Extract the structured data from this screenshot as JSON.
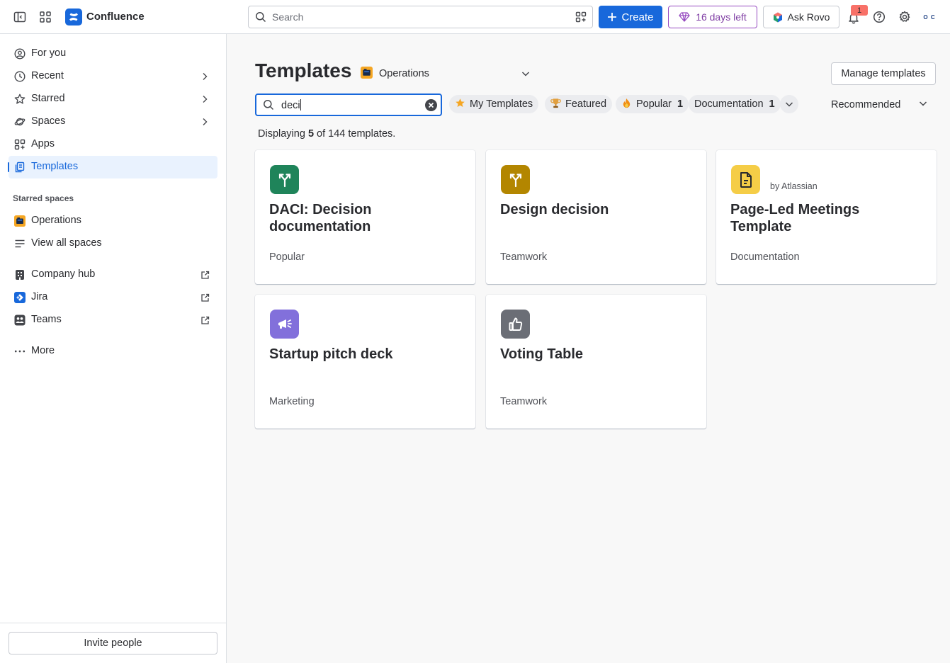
{
  "topbar": {
    "brand": "Confluence",
    "search_placeholder": "Search",
    "create_label": "Create",
    "trial_label": "16 days left",
    "rovo_label": "Ask Rovo",
    "notification_count": "1",
    "avatar_text": "O C"
  },
  "sidebar": {
    "items": [
      {
        "label": "For you"
      },
      {
        "label": "Recent"
      },
      {
        "label": "Starred"
      },
      {
        "label": "Spaces"
      },
      {
        "label": "Apps"
      },
      {
        "label": "Templates"
      }
    ],
    "starred_spaces_title": "Starred spaces",
    "starred_spaces": [
      {
        "label": "Operations"
      },
      {
        "label": "View all spaces"
      }
    ],
    "external": [
      {
        "label": "Company hub"
      },
      {
        "label": "Jira"
      },
      {
        "label": "Teams"
      }
    ],
    "more_label": "More",
    "invite_label": "Invite people"
  },
  "main": {
    "title": "Templates",
    "space_name": "Operations",
    "manage_label": "Manage templates",
    "search_value": "deci",
    "filters": [
      {
        "label": "My Templates",
        "count": ""
      },
      {
        "label": "Featured",
        "count": ""
      },
      {
        "label": "Popular",
        "count": "1"
      },
      {
        "label": "Documentation",
        "count": "1"
      }
    ],
    "sort_label": "Recommended",
    "display_prefix": "Displaying",
    "display_shown": "5",
    "display_mid": "of 144 templates.",
    "cards": [
      {
        "title": "DACI: Decision documentation",
        "category": "Popular",
        "by": "",
        "icon": "decision-icon",
        "color": "#1f845a"
      },
      {
        "title": "Design decision",
        "category": "Teamwork",
        "by": "",
        "icon": "decision-icon",
        "color": "#b38600"
      },
      {
        "title": "Page-Led Meetings Template",
        "category": "Documentation",
        "by": "by Atlassian",
        "icon": "page-icon",
        "color": "#f5cd47"
      },
      {
        "title": "Startup pitch deck",
        "category": "Marketing",
        "by": "",
        "icon": "megaphone-icon",
        "color": "#8270db"
      },
      {
        "title": "Voting Table",
        "category": "Teamwork",
        "by": "",
        "icon": "thumbs-up-icon",
        "color": "#6b6e76"
      }
    ]
  }
}
